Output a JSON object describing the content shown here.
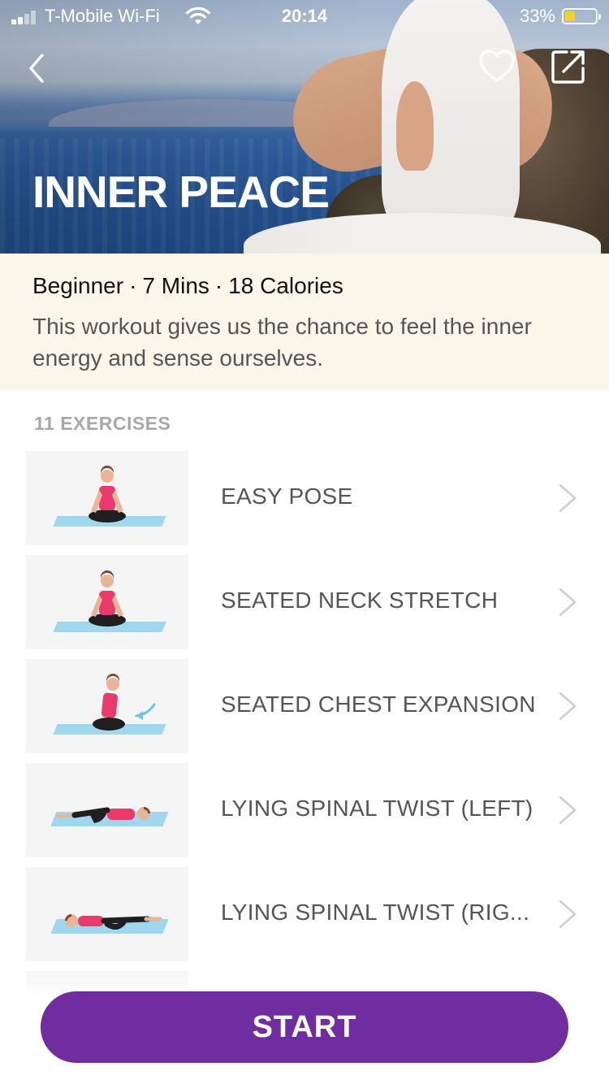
{
  "status_bar": {
    "carrier": "T-Mobile Wi-Fi",
    "time": "20:14",
    "battery_percent": "33%",
    "battery_level": 0.33
  },
  "header": {
    "title": "INNER PEACE"
  },
  "info": {
    "level": "Beginner",
    "duration": "7 Mins",
    "calories": "18 Calories",
    "separator": "·",
    "description": "This workout gives us the chance to feel the inner energy and sense ourselves."
  },
  "exercises": {
    "count_label": "11 EXERCISES",
    "items": [
      {
        "name": "EASY POSE"
      },
      {
        "name": "SEATED NECK STRETCH"
      },
      {
        "name": "SEATED CHEST EXPANSION"
      },
      {
        "name": "LYING SPINAL TWIST (LEFT)"
      },
      {
        "name": "LYING SPINAL TWIST (RIG..."
      }
    ]
  },
  "actions": {
    "start_label": "START"
  },
  "colors": {
    "accent": "#6f2da0",
    "info_bg": "#faf7ea",
    "mat": "#9fd7ef",
    "top_pink": "#e93a6b",
    "pants": "#1f1f1f"
  }
}
